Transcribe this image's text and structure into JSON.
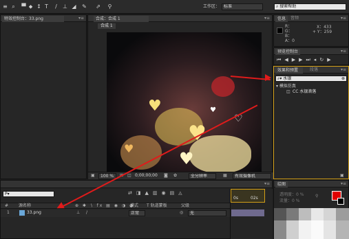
{
  "toolbar": {
    "workspace_label": "工作区：",
    "workspace_value": "标准",
    "search_help": "搜索帮助"
  },
  "project_panel": {
    "tab_label": "特效控制台：33.png",
    "menu": "▾≡"
  },
  "comp_panel": {
    "tab_label": "合成：合成 1",
    "sub_tab": "合成 1",
    "footer_zoom": "100 %",
    "footer_time": "0;00;00;00",
    "footer_res": "全分辨率",
    "footer_view": "有效摄像机"
  },
  "info_panel": {
    "tab_label": "信息",
    "tab2_label": "音频",
    "r": "R：",
    "g": "G：",
    "b": "B：",
    "a": "A：0",
    "x": "X：433",
    "y": "+ Y：259"
  },
  "preview_panel": {
    "tab_label": "预览控制台"
  },
  "effects_panel": {
    "tab_label": "效果和预置",
    "tab2_label": "段落",
    "search_value": "水银",
    "category": "▾ 模拟仿真",
    "item": "CC 水银滴落"
  },
  "timeline": {
    "search_placeholder": "P▾",
    "col_source": "源名称",
    "col_mode": "模式",
    "col_track": "T  轨道蒙板",
    "col_parent": "父级",
    "ruler_start": "0s",
    "ruler_mark": "02s",
    "layer_index": "1",
    "layer_name": "33.png",
    "layer_mode": "正常",
    "layer_parent": "无"
  },
  "brush_panel": {
    "tab_label": "绘图",
    "opacity_label": "透明度：0 %",
    "flow_label": "流量：0 %"
  },
  "colors": {
    "accent_yellow": "#d4a017",
    "arrow_red": "#e01b1b"
  }
}
